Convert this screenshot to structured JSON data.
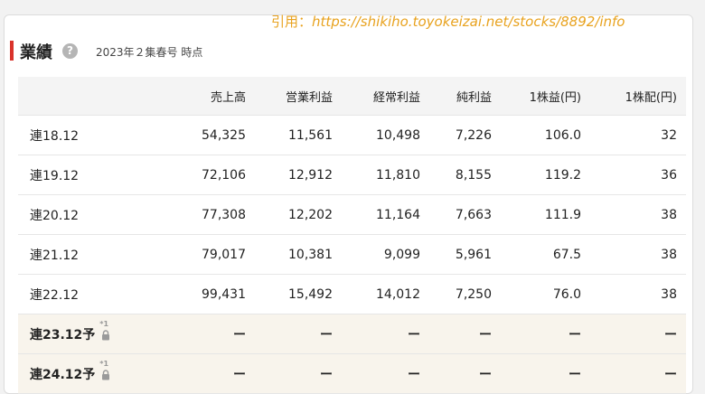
{
  "header": {
    "title": "業績",
    "help_glyph": "?",
    "as_of": "2023年２集春号 時点",
    "citation_prefix": "引用：",
    "citation_url": "https://shikiho.toyokeizai.net/stocks/8892/info"
  },
  "table": {
    "columns": [
      "売上高",
      "営業利益",
      "経常利益",
      "純利益",
      "1株益(円)",
      "1株配(円)"
    ],
    "rows": [
      {
        "period": "連18.12",
        "values": [
          "54,325",
          "11,561",
          "10,498",
          "7,226",
          "106.0",
          "32"
        ]
      },
      {
        "period": "連19.12",
        "values": [
          "72,106",
          "12,912",
          "11,810",
          "8,155",
          "119.2",
          "36"
        ]
      },
      {
        "period": "連20.12",
        "values": [
          "77,308",
          "12,202",
          "11,164",
          "7,663",
          "111.9",
          "38"
        ]
      },
      {
        "period": "連21.12",
        "values": [
          "79,017",
          "10,381",
          "9,099",
          "5,961",
          "67.5",
          "38"
        ]
      },
      {
        "period": "連22.12",
        "values": [
          "99,431",
          "15,492",
          "14,012",
          "7,250",
          "76.0",
          "38"
        ]
      }
    ],
    "forecast_rows": [
      {
        "period": "連23.12予",
        "lock_mark": "*1",
        "values": [
          "ー",
          "ー",
          "ー",
          "ー",
          "ー",
          "ー"
        ]
      },
      {
        "period": "連24.12予",
        "lock_mark": "*1",
        "values": [
          "ー",
          "ー",
          "ー",
          "ー",
          "ー",
          "ー"
        ]
      }
    ]
  },
  "icons": {
    "help": "question-circle-icon",
    "lock": "lock-icon"
  },
  "colors": {
    "accent_bar": "#d9332b",
    "citation": "#e8a21e",
    "forecast_bg": "#f8f4ec"
  }
}
